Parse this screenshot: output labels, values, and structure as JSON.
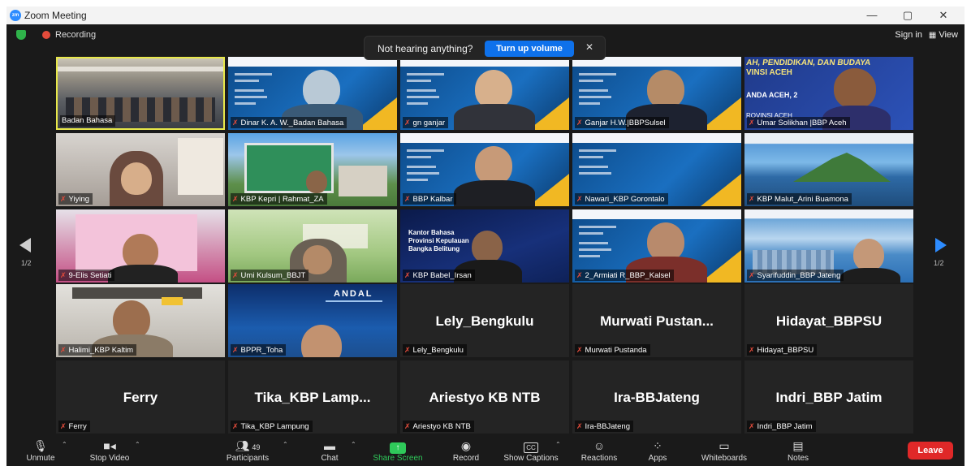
{
  "window": {
    "title": "Zoom Meeting",
    "controls": [
      "—",
      "▢",
      "✕"
    ]
  },
  "topbar": {
    "recording": "Recording",
    "sign_in": "Sign in",
    "view": "View"
  },
  "notification": {
    "message": "Not hearing anything?",
    "button": "Turn up volume",
    "close": "✕"
  },
  "pagination": {
    "left": "1/2",
    "right": "1/2"
  },
  "tiles": [
    {
      "name": "Badan Bahasa",
      "big": ""
    },
    {
      "name": "Dinar K. A. W._Badan Bahasa",
      "big": ""
    },
    {
      "name": "gn ganjar",
      "big": ""
    },
    {
      "name": "Ganjar H.W.|BBPSulsel",
      "big": ""
    },
    {
      "name": "Umar Solikhan |BBP Aceh",
      "big": ""
    },
    {
      "name": "Yiying",
      "big": ""
    },
    {
      "name": "KBP Kepri | Rahmat_ZA",
      "big": ""
    },
    {
      "name": "BBP Kalbar",
      "big": ""
    },
    {
      "name": "Nawari_KBP Gorontalo",
      "big": ""
    },
    {
      "name": "KBP Malut_Arini Buamona",
      "big": ""
    },
    {
      "name": "9-Elis Setiati",
      "big": ""
    },
    {
      "name": "Umi Kulsum_BBJT",
      "big": ""
    },
    {
      "name": "KBP Babel_Irsan",
      "big": ""
    },
    {
      "name": "2_Armiati R_BBP_Kalsel",
      "big": ""
    },
    {
      "name": "Syarifuddin_BBP Jateng",
      "big": ""
    },
    {
      "name": "Halimi_KBP Kaltim",
      "big": ""
    },
    {
      "name": "BPPR_Toha",
      "big": ""
    },
    {
      "name": "Lely_Bengkulu",
      "big": "Lely_Bengkulu"
    },
    {
      "name": "Murwati Pustanda",
      "big": "Murwati  Pustan..."
    },
    {
      "name": "Hidayat_BBPSU",
      "big": "Hidayat_BBPSU"
    },
    {
      "name": "Ferry",
      "big": "Ferry"
    },
    {
      "name": "Tika_KBP Lampung",
      "big": "Tika_KBP  Lamp..."
    },
    {
      "name": "Ariestyo KB NTB",
      "big": "Ariestyo KB NTB"
    },
    {
      "name": "Ira-BBJateng",
      "big": "Ira-BBJateng"
    },
    {
      "name": "Indri_BBP Jatim",
      "big": "Indri_BBP  Jatim"
    }
  ],
  "slide_text": {
    "andal": "ANDAL",
    "babel_lines": [
      "Kantor Bahasa",
      "Provinsi Kepulauan",
      "Bangka Belitung"
    ],
    "aceh": [
      "AH, PENDIDIKAN, DAN BUDAYA",
      "VINSI ACEH",
      "ANDA ACEH, 2",
      "ROVINSI ACEH"
    ]
  },
  "toolbar": {
    "unmute": "Unmute",
    "stop_video": "Stop Video",
    "participants": "Participants",
    "participants_count": "49",
    "chat": "Chat",
    "share": "Share Screen",
    "record": "Record",
    "captions": "Show Captions",
    "captions_icon": "CC",
    "reactions": "Reactions",
    "apps": "Apps",
    "whiteboards": "Whiteboards",
    "notes": "Notes",
    "leave": "Leave"
  },
  "colors": {
    "accent": "#0e71eb",
    "share": "#2fc95a",
    "leave": "#e02828",
    "active_border": "#e8e84a"
  }
}
